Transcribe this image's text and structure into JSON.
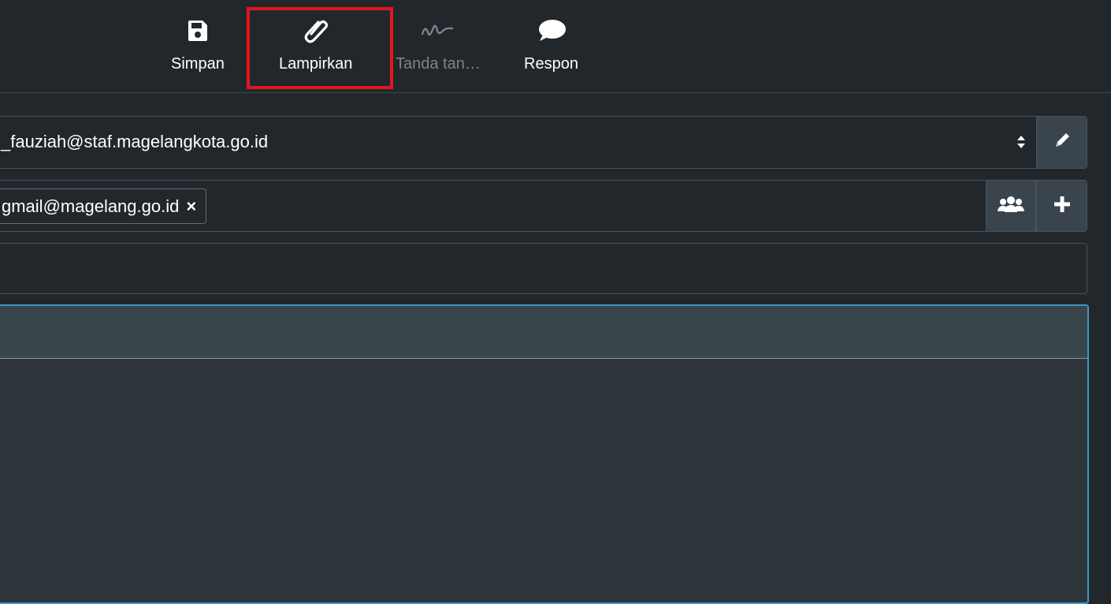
{
  "toolbar": {
    "save": {
      "label": "Simpan",
      "icon": "save-icon"
    },
    "attach": {
      "label": "Lampirkan",
      "icon": "paperclip-icon"
    },
    "signature": {
      "label": "Tanda tan…",
      "icon": "signature-icon",
      "enabled": false
    },
    "respond": {
      "label": "Respon",
      "icon": "speech-bubble-icon"
    }
  },
  "highlight_color": "#e3151f",
  "from": {
    "value": "_fauziah@staf.magelangkota.go.id"
  },
  "to": {
    "recipients": [
      {
        "label": "gmail@magelang.go.id",
        "remove": "×"
      }
    ]
  },
  "subject": {
    "value": ""
  },
  "colors": {
    "background": "#22272b",
    "editor_focus_border": "#3e95c8",
    "editor_toolbar": "#38454b"
  }
}
